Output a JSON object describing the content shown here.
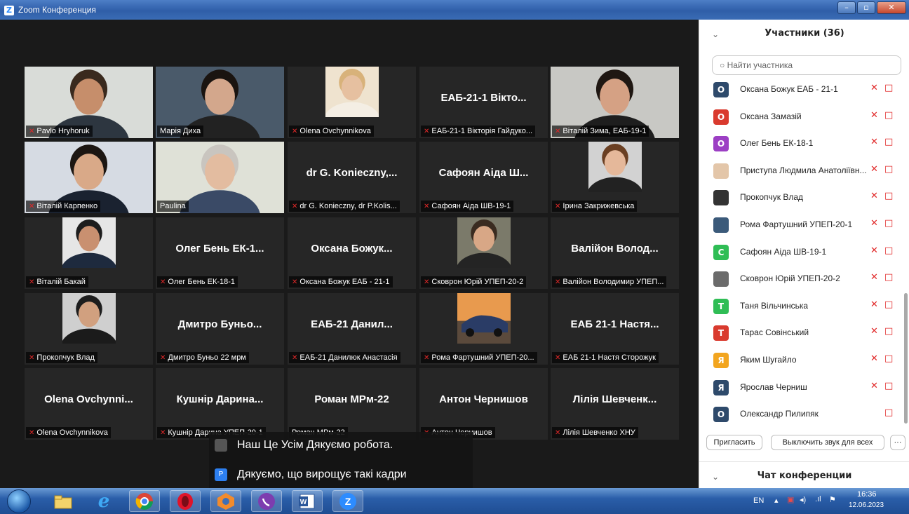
{
  "window": {
    "title": "Zoom Конференция"
  },
  "tiles": [
    {
      "row": 0,
      "col": 0,
      "label": "Pavlo Hryhoruk",
      "big": "",
      "muted": true,
      "photo": "man-glasses-office"
    },
    {
      "row": 0,
      "col": 1,
      "label": "Марія Диха",
      "big": "",
      "muted": false,
      "photo": "woman-dark-hair-books"
    },
    {
      "row": 0,
      "col": 2,
      "label": "Olena Ovchynnikova",
      "big": "",
      "muted": true,
      "photo": "woman-blonde"
    },
    {
      "row": 0,
      "col": 3,
      "label": "ЕАБ-21-1 Вікторія Гайдуко...",
      "big": "ЕАБ-21-1 Вікто...",
      "muted": true,
      "photo": ""
    },
    {
      "row": 0,
      "col": 4,
      "label": "Віталій Зима, ЕАБ-19-1",
      "big": "",
      "muted": true,
      "photo": "man-headphones"
    },
    {
      "row": 1,
      "col": 0,
      "label": "Віталій Карпенко",
      "big": "",
      "muted": true,
      "photo": "man-dark-hair"
    },
    {
      "row": 1,
      "col": 1,
      "label": "Paulina",
      "big": "",
      "muted": false,
      "photo": "woman-grey-hair",
      "highlight": true
    },
    {
      "row": 1,
      "col": 2,
      "label": "dr G. Konieczny, dr P.Kolis...",
      "big": "dr G. Konieczny,...",
      "muted": true,
      "photo": ""
    },
    {
      "row": 1,
      "col": 3,
      "label": "Сафоян Аіда ШВ-19-1",
      "big": "Сафоян Аіда Ш...",
      "muted": true,
      "photo": ""
    },
    {
      "row": 1,
      "col": 4,
      "label": "Ірина Закрижевська",
      "big": "",
      "muted": true,
      "photo": "woman-portrait"
    },
    {
      "row": 2,
      "col": 0,
      "label": "Віталій Бакай",
      "big": "",
      "muted": true,
      "photo": "man-suit"
    },
    {
      "row": 2,
      "col": 1,
      "label": "Олег Бень ЕК-18-1",
      "big": "Олег Бень ЕК-1...",
      "muted": true,
      "photo": ""
    },
    {
      "row": 2,
      "col": 2,
      "label": "Оксана Божук ЕАБ - 21-1",
      "big": "Оксана Божук...",
      "muted": true,
      "photo": ""
    },
    {
      "row": 2,
      "col": 3,
      "label": "Сковрон Юрій УПЕП-20-2",
      "big": "",
      "muted": true,
      "photo": "young-man"
    },
    {
      "row": 2,
      "col": 4,
      "label": "Валійон Володимир УПЕП...",
      "big": "Валійон Волод...",
      "muted": true,
      "photo": ""
    },
    {
      "row": 3,
      "col": 0,
      "label": "Прокопчук Влад",
      "big": "",
      "muted": true,
      "photo": "man-balloons"
    },
    {
      "row": 3,
      "col": 1,
      "label": "Дмитро Буньо 22 мрм",
      "big": "Дмитро Буньо...",
      "muted": true,
      "photo": ""
    },
    {
      "row": 3,
      "col": 2,
      "label": "ЕАБ-21 Данилюк Анастасія",
      "big": "ЕАБ-21 Данил...",
      "muted": true,
      "photo": ""
    },
    {
      "row": 3,
      "col": 3,
      "label": "Рома Фартушний УПЕП-20...",
      "big": "",
      "muted": true,
      "photo": "car"
    },
    {
      "row": 3,
      "col": 4,
      "label": "ЕАБ 21-1 Настя Сторожук",
      "big": "ЕАБ 21-1 Настя...",
      "muted": true,
      "photo": ""
    },
    {
      "row": 4,
      "col": 0,
      "label": "Olena Ovchynnikova",
      "big": "Olena Ovchynni...",
      "muted": true,
      "photo": ""
    },
    {
      "row": 4,
      "col": 1,
      "label": "Кушнір Дарина УПЕП-20-1",
      "big": "Кушнір Дарина...",
      "muted": true,
      "photo": ""
    },
    {
      "row": 4,
      "col": 2,
      "label": "Роман МРм-22",
      "big": "Роман МРм-22",
      "muted": false,
      "photo": ""
    },
    {
      "row": 4,
      "col": 3,
      "label": "Антон Чернишов",
      "big": "Антон Чернишов",
      "muted": true,
      "photo": ""
    },
    {
      "row": 4,
      "col": 4,
      "label": "Лілія Шевченко ХНУ",
      "big": "Лілія Шевченк...",
      "muted": true,
      "photo": ""
    }
  ],
  "chat_overlay": [
    {
      "avatar": "photo",
      "avatar_color": "#555555",
      "text": "Наш Це Усім Дякуємо робота."
    },
    {
      "avatar": "P",
      "avatar_color": "#2d7ff0",
      "text": "Дякуємо, що вирощує такі кадри"
    }
  ],
  "panel": {
    "title": "Участники (36)",
    "search_placeholder": "Найти участника",
    "participants": [
      {
        "initial": "О",
        "color": "#2e4a6b",
        "name": "Оксана Божук ЕАБ - 21-1",
        "mic_muted": true
      },
      {
        "initial": "О",
        "color": "#d93a2e",
        "name": "Оксана Замазій",
        "mic_muted": true
      },
      {
        "initial": "О",
        "color": "#9c3fc4",
        "name": "Олег Бень ЕК-18-1",
        "mic_muted": true
      },
      {
        "initial": "",
        "color": "#e3c6a9",
        "name": "Приступа Людмила Анатоліївн...",
        "mic_muted": true
      },
      {
        "initial": "",
        "color": "#333333",
        "name": "Прокопчук Влад",
        "mic_muted": true
      },
      {
        "initial": "",
        "color": "#3b5a7a",
        "name": "Рома Фартушний УПЕП-20-1",
        "mic_muted": true
      },
      {
        "initial": "С",
        "color": "#2fbd55",
        "name": "Сафоян Аіда ШВ-19-1",
        "mic_muted": true
      },
      {
        "initial": "",
        "color": "#6b6b6b",
        "name": "Сковрон Юрій УПЕП-20-2",
        "mic_muted": true
      },
      {
        "initial": "Т",
        "color": "#2fbd55",
        "name": "Таня Вільчинська",
        "mic_muted": true
      },
      {
        "initial": "Т",
        "color": "#d93a2e",
        "name": "Тарас Совінський",
        "mic_muted": true
      },
      {
        "initial": "Я",
        "color": "#f2a51f",
        "name": "Яким Шугайло",
        "mic_muted": true
      },
      {
        "initial": "Я",
        "color": "#2e4a6b",
        "name": "Ярослав Черниш",
        "mic_muted": true
      },
      {
        "initial": "О",
        "color": "#2e4a6b",
        "name": "Олександр Пилипяк",
        "mic_muted": false
      }
    ],
    "invite_label": "Пригласить",
    "mute_all_label": "Выключить звук для всех",
    "more_label": "···",
    "chat_title": "Чат конференции"
  },
  "taskbar": {
    "apps": [
      "explorer",
      "ie",
      "chrome",
      "opera",
      "app",
      "viber",
      "word",
      "zoom"
    ],
    "lang": "EN",
    "time": "16:36",
    "date": "12.06.2023"
  }
}
